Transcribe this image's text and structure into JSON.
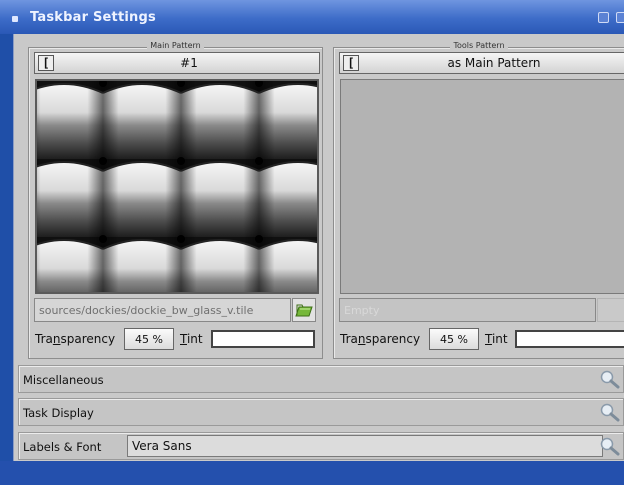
{
  "window": {
    "title": "Taskbar Settings"
  },
  "main_pattern": {
    "group_title": "Main Pattern",
    "pattern_name": "#1",
    "file_path": "sources/dockies/dockie_bw_glass_v.tile",
    "transparency_label_pre": "Tra",
    "transparency_label_u": "n",
    "transparency_label_post": "sparency",
    "transparency_value": "45 %",
    "tint_label_u": "T",
    "tint_label_post": "int",
    "tint_color": "#ffffff"
  },
  "tools_pattern": {
    "group_title": "Tools Pattern",
    "pattern_name": "as Main Pattern",
    "file_placeholder": "Empty",
    "transparency_label_pre": "Tra",
    "transparency_label_u": "n",
    "transparency_label_post": "sparency",
    "transparency_value": "45 %",
    "tint_label_u": "T",
    "tint_label_post": "int",
    "tint_color": "#ffffff"
  },
  "sections": {
    "misc_label": "Miscellaneous",
    "task_display_label": "Task Display",
    "labels_font_label": "Labels & Font",
    "font_value": "Vera Sans"
  },
  "icons": {
    "rotate": "rotate-icon",
    "browse": "open-folder-icon",
    "expand": "magnifier-icon"
  }
}
